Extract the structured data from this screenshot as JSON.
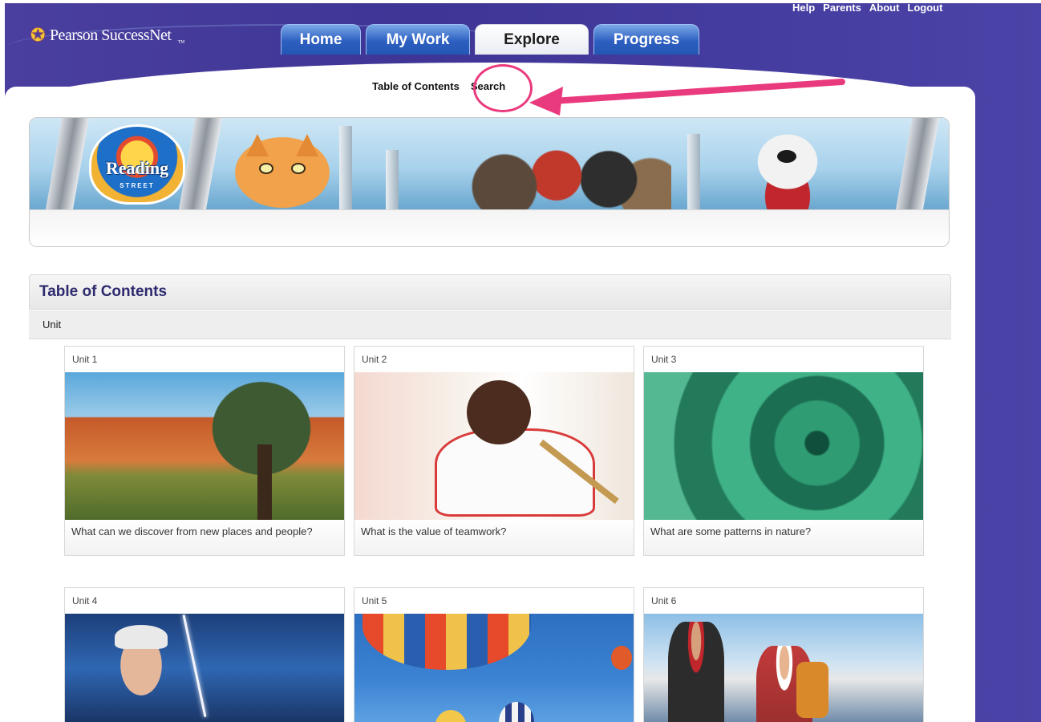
{
  "header": {
    "logo_text": "Pearson SuccessNet",
    "logo_tm": "™",
    "util_links": [
      "Help",
      "Parents",
      "About",
      "Logout"
    ],
    "tabs": [
      {
        "label": "Home",
        "active": false
      },
      {
        "label": "My Work",
        "active": false
      },
      {
        "label": "Explore",
        "active": true
      },
      {
        "label": "Progress",
        "active": false
      }
    ]
  },
  "subnav": {
    "items": [
      "Table of Contents",
      "Search"
    ],
    "highlighted": "Search",
    "annotation_color": "#ea3a7e"
  },
  "banner": {
    "badge_title": "Reading",
    "badge_subtitle": "STREET"
  },
  "toc": {
    "title": "Table of Contents",
    "filter_label": "Unit",
    "units": [
      {
        "title": "Unit 1",
        "caption": "What can we discover from new places and people?",
        "image": "canyon-landscape"
      },
      {
        "title": "Unit 2",
        "caption": "What is the value of teamwork?",
        "image": "tug-of-war"
      },
      {
        "title": "Unit 3",
        "caption": "What are some patterns in nature?",
        "image": "spiral-aloe"
      },
      {
        "title": "Unit 4",
        "caption": "",
        "image": "storm-man"
      },
      {
        "title": "Unit 5",
        "caption": "",
        "image": "hot-air-balloons"
      },
      {
        "title": "Unit 6",
        "caption": "",
        "image": "mountain-climbers"
      }
    ]
  },
  "colors": {
    "background": "#3e3596",
    "tab_blue": "#2d5fc0",
    "toc_title": "#2d2a6e"
  }
}
